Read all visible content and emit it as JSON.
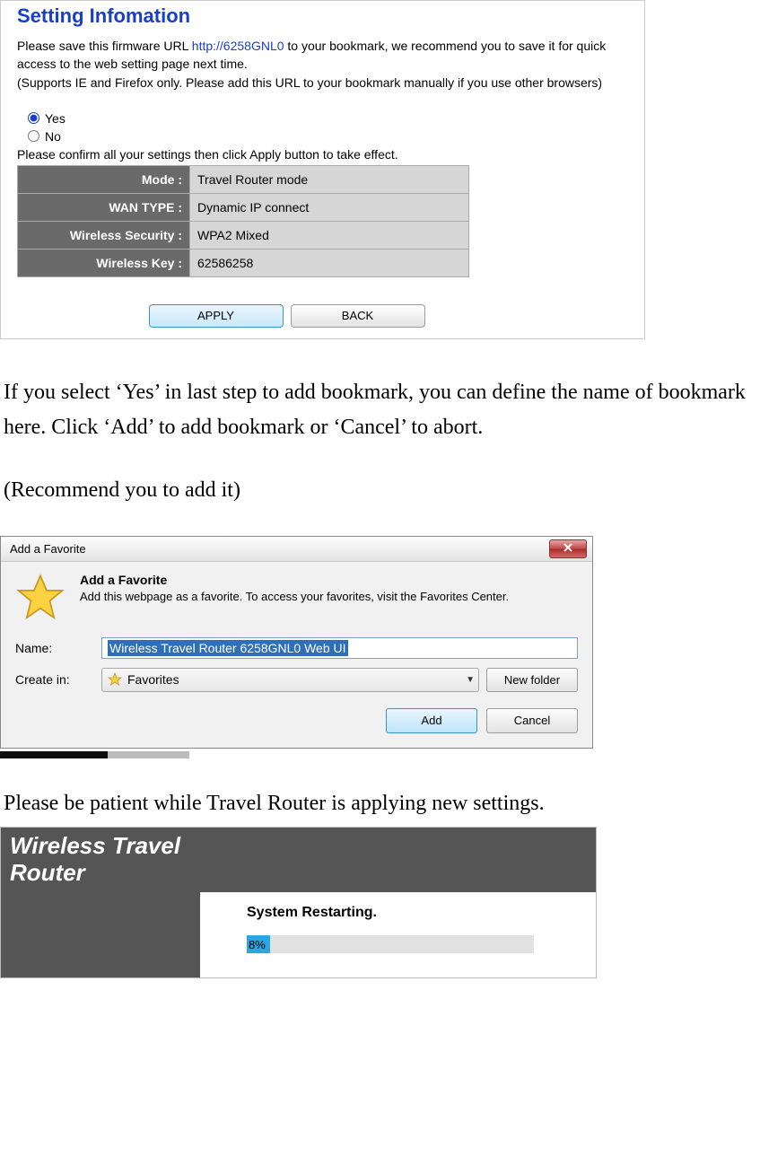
{
  "settings_panel": {
    "heading": "Setting Infomation",
    "desc_before_url": "Please save this firmware URL ",
    "url": "http://6258GNL0",
    "desc_after_url": " to your bookmark, we recommend you to save it for quick access to the web setting page next time.",
    "desc_line2": "(Supports IE and Firefox only. Please add this URL to your bookmark manually if you use other browsers)",
    "radio_yes": "Yes",
    "radio_no": "No",
    "confirm_text": "Please confirm all your settings then click Apply button to take effect.",
    "rows": [
      {
        "label": "Mode :",
        "value": "Travel Router mode"
      },
      {
        "label": "WAN TYPE :",
        "value": "Dynamic IP connect"
      },
      {
        "label": "Wireless Security :",
        "value": "WPA2 Mixed"
      },
      {
        "label": "Wireless Key :",
        "value": "62586258"
      }
    ],
    "apply_label": "APPLY",
    "back_label": "BACK"
  },
  "doc": {
    "p1": "If you select ‘Yes’ in last step to add bookmark, you can define the name of bookmark here. Click ‘Add’ to add bookmark or ‘Cancel’ to abort.",
    "p2": "(Recommend you to add it)",
    "p3": "Please be patient while Travel Router is applying new settings."
  },
  "fav_dialog": {
    "title": "Add a Favorite",
    "heading": "Add a Favorite",
    "subtext": "Add this webpage as a favorite. To access your favorites, visit the Favorites Center.",
    "name_label": "Name:",
    "name_value": "Wireless Travel Router 6258GNL0 Web UI",
    "createin_label": "Create in:",
    "createin_value": "Favorites",
    "newfolder_label": "New folder",
    "add_label": "Add",
    "cancel_label": "Cancel"
  },
  "restart": {
    "header_line1": "Wireless Travel",
    "header_line2": "Router",
    "status_title": "System Restarting.",
    "progress_percent": 8,
    "progress_label": "8%"
  }
}
